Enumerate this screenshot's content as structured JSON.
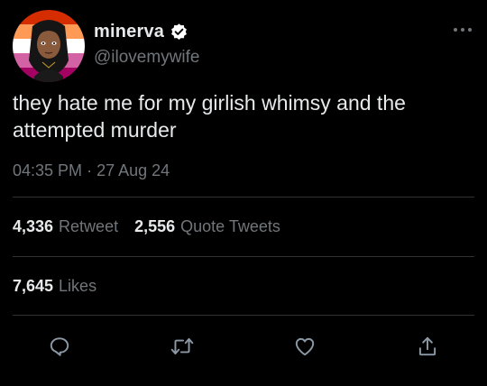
{
  "user": {
    "display_name": "minerva",
    "handle": "@ilovemywife",
    "verified": true
  },
  "tweet": {
    "text": "they hate me for my girlish whimsy and the attempted murder",
    "time": "04:35 PM",
    "separator": "·",
    "date": "27 Aug 24"
  },
  "stats": {
    "retweets_count": "4,336",
    "retweets_label": "Retweet",
    "quotes_count": "2,556",
    "quotes_label": "Quote Tweets",
    "likes_count": "7,645",
    "likes_label": "Likes"
  },
  "icons": {
    "more": "more-horizontal-icon",
    "verified": "verified-badge-icon",
    "reply": "reply-icon",
    "retweet": "retweet-icon",
    "like": "like-icon",
    "share": "share-icon"
  },
  "colors": {
    "background": "#000000",
    "text_primary": "#e7e9ea",
    "text_secondary": "#71767b",
    "divider": "#2f3336",
    "icon": "#8b98a5",
    "verified_badge": "#ffffff",
    "avatar_flag_stripes": [
      "#d52d00",
      "#ff9a56",
      "#ffffff",
      "#d362a4",
      "#a30262"
    ]
  }
}
